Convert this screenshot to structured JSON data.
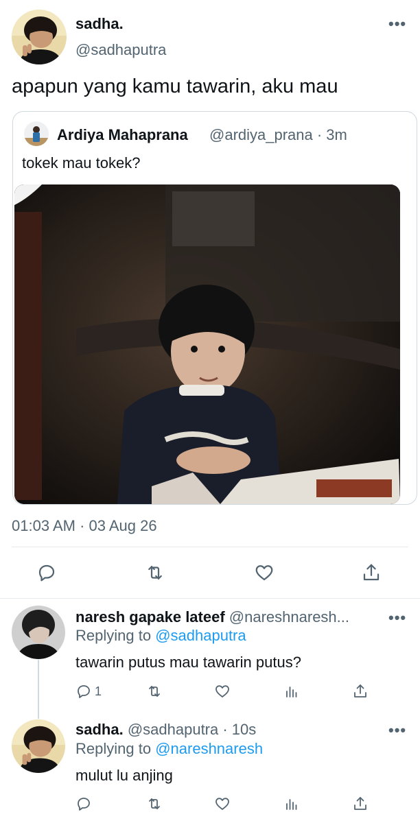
{
  "main_tweet": {
    "name": "sadha.",
    "handle": "@sadhaputra",
    "more": "•••",
    "text": "apapun yang kamu tawarin, aku mau",
    "timestamp": "01:03 AM · 03 Aug 26"
  },
  "quoted_tweet": {
    "name": "Ardiya Mahaprana",
    "handle": "@ardiya_prana · 3m",
    "text": "tokek mau tokek?"
  },
  "replies": [
    {
      "name": "naresh gapake lateef",
      "handle": "@nareshnaresh...",
      "more": "•••",
      "replying_prefix": "Replying to",
      "replying_to": "@sadhaputra",
      "text": "tawarin putus mau tawarin putus?",
      "reply_count": "1"
    },
    {
      "name": "sadha.",
      "handle": "@sadhaputra · 10s",
      "more": "•••",
      "replying_prefix": "Replying to",
      "replying_to": "@nareshnaresh",
      "text": "mulut lu anjing"
    }
  ],
  "icons": {
    "reply": "reply-icon",
    "retweet": "retweet-icon",
    "like": "like-icon",
    "share": "share-icon",
    "analytics": "analytics-icon",
    "more": "more-icon"
  },
  "colors": {
    "text": "#0f1419",
    "secondary": "#536471",
    "link": "#1d9bf0",
    "border": "#cfd9de"
  }
}
